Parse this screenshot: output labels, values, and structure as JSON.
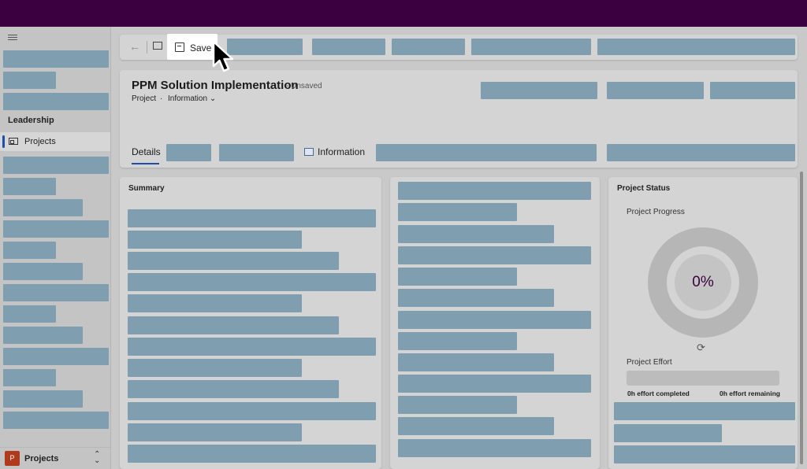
{
  "command_bar": {
    "back_icon": "back-arrow-icon",
    "popout_icon": "open-in-new-window-icon",
    "save_label": "Save",
    "save_icon": "save-disk-icon"
  },
  "sidebar": {
    "section_title": "Leadership",
    "active_item": "Projects",
    "area": {
      "badge": "P",
      "label": "Projects"
    }
  },
  "header": {
    "title": "PPM Solution Implementation",
    "status": "- Unsaved",
    "entity": "Project",
    "separator": "·",
    "form": "Information",
    "tabs": {
      "details": "Details",
      "information": "Information"
    }
  },
  "summary": {
    "title": "Summary"
  },
  "status": {
    "title": "Project Status",
    "progress_label": "Project Progress",
    "progress_value": "0%",
    "effort_label": "Project Effort",
    "effort_completed": "0h effort completed",
    "effort_remaining": "0h effort remaining"
  },
  "colors": {
    "topbar": "#3b0040",
    "placeholder": "#7f9fb0",
    "accent": "#1e4fa8",
    "area_badge": "#b03a1b"
  }
}
